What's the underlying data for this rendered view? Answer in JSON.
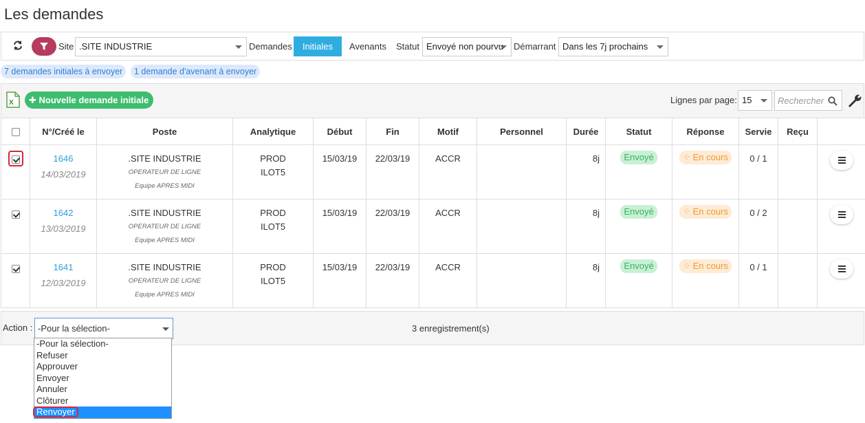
{
  "page": {
    "title": "Les demandes"
  },
  "filters": {
    "site_label": "Site",
    "site_value": ".SITE INDUSTRIE",
    "demandes_label": "Demandes",
    "tab_initiales": "Initiales",
    "tab_avenants": "Avenants",
    "statut_label": "Statut",
    "statut_value": "Envoyé non pourvu",
    "demarrant_label": "Démarrant",
    "demarrant_value": "Dans les 7j prochains"
  },
  "pills": {
    "initiales": "7 demandes initiales à envoyer",
    "avenant": "1 demande d'avenant à envoyer"
  },
  "toolbar": {
    "new_button": "Nouvelle demande initiale",
    "lines_label": "Lignes par page:",
    "lines_value": "15",
    "search_placeholder": "Rechercher"
  },
  "table": {
    "headers": [
      "N°/Créé le",
      "Poste",
      "Analytique",
      "Début",
      "Fin",
      "Motif",
      "Personnel",
      "Durée",
      "Statut",
      "Réponse",
      "Servie",
      "Reçu"
    ],
    "rows": [
      {
        "num": "1646",
        "date": "14/03/2019",
        "site": ".SITE INDUSTRIE",
        "poste": "OPERATEUR DE LIGNE",
        "equipe": "Equipe APRES MIDI",
        "analytique1": "PROD",
        "analytique2": "ILOT5",
        "debut": "15/03/19",
        "fin": "22/03/19",
        "motif": "ACCR",
        "personnel": "",
        "duree": "8j",
        "statut": "Envoyé",
        "reponse": "En cours",
        "servie": "0 / 1",
        "recu": ""
      },
      {
        "num": "1642",
        "date": "13/03/2019",
        "site": ".SITE INDUSTRIE",
        "poste": "OPERATEUR DE LIGNE",
        "equipe": "Equipe APRES MIDI",
        "analytique1": "PROD",
        "analytique2": "ILOT5",
        "debut": "15/03/19",
        "fin": "22/03/19",
        "motif": "ACCR",
        "personnel": "",
        "duree": "8j",
        "statut": "Envoyé",
        "reponse": "En cours",
        "servie": "0 / 2",
        "recu": ""
      },
      {
        "num": "1641",
        "date": "12/03/2019",
        "site": ".SITE INDUSTRIE",
        "poste": "OPERATEUR DE LIGNE",
        "equipe": "Equipe APRES MIDI",
        "analytique1": "PROD",
        "analytique2": "ILOT5",
        "debut": "15/03/19",
        "fin": "22/03/19",
        "motif": "ACCR",
        "personnel": "",
        "duree": "8j",
        "statut": "Envoyé",
        "reponse": "En cours",
        "servie": "0 / 1",
        "recu": ""
      }
    ]
  },
  "footer": {
    "action_label": "Action :",
    "action_value": "-Pour la sélection-",
    "records": "3 enregistrement(s)",
    "options": [
      "-Pour la sélection-",
      "Refuser",
      "Approuver",
      "Envoyer",
      "Annuler",
      "Clôturer",
      "Renvoyer"
    ]
  },
  "colors": {
    "accent": "#2eaee0",
    "filter_button": "#b63c5e",
    "success": "#3ebd6f",
    "highlight": "#d9263a"
  }
}
